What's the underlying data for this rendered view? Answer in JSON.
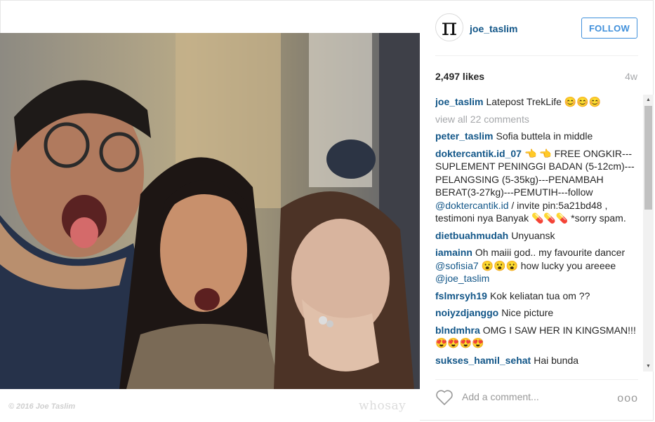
{
  "post": {
    "username": "joe_taslim",
    "avatar_glyph": "π",
    "follow_label": "FOLLOW",
    "likes": "2,497 likes",
    "age": "4w",
    "caption_user": "joe_taslim",
    "caption_text": "Latepost TrekLife 😊😊😊",
    "view_all": "view all 22 comments",
    "add_comment_placeholder": "Add a comment...",
    "more_glyph": "ooo"
  },
  "photo": {
    "copyright": "© 2016 Joe Taslim",
    "watermark": "whosay"
  },
  "comments": [
    {
      "user": "peter_taslim",
      "parts": [
        {
          "t": "Sofia buttela in middle"
        }
      ]
    },
    {
      "user": "doktercantik.id_07",
      "parts": [
        {
          "t": "👈 👈 FREE ONGKIR---SUPLEMENT PENINGGI BADAN (5-12cm)---PELANGSING (5-35kg)---PENAMBAH BERAT(3-27kg)---PEMUTIH---follow "
        },
        {
          "t": "@doktercantik.id",
          "m": true
        },
        {
          "t": " / invite pin:5a21bd48 , testimoni nya Banyak 💊💊💊 *sorry spam."
        }
      ]
    },
    {
      "user": "dietbuahmudah",
      "parts": [
        {
          "t": "Unyuansk"
        }
      ]
    },
    {
      "user": "iamainn",
      "parts": [
        {
          "t": "Oh maiii god.. my favourite dancer "
        },
        {
          "t": "@sofisia7",
          "m": true
        },
        {
          "t": " 😮😮😮 how lucky you areeee "
        },
        {
          "t": "@joe_taslim",
          "m": true
        }
      ]
    },
    {
      "user": "fslmrsyh19",
      "parts": [
        {
          "t": "Kok keliatan tua om ??"
        }
      ]
    },
    {
      "user": "noiyzdjanggo",
      "parts": [
        {
          "t": "Nice picture"
        }
      ]
    },
    {
      "user": "blndmhra",
      "parts": [
        {
          "t": "OMG I SAW HER IN KINGSMAN!!!😍😍😍😍"
        }
      ]
    },
    {
      "user": "sukses_hamil_sehat",
      "parts": [
        {
          "t": "Hai bunda"
        }
      ]
    }
  ],
  "colors": {
    "accent": "#125688",
    "follow_border": "#4090db",
    "muted": "#a5a7aa"
  },
  "icons": {
    "heart": "heart-icon",
    "more": "more-options-icon",
    "scroll_up": "scroll-up-arrow-icon",
    "scroll_down": "scroll-down-arrow-icon"
  }
}
